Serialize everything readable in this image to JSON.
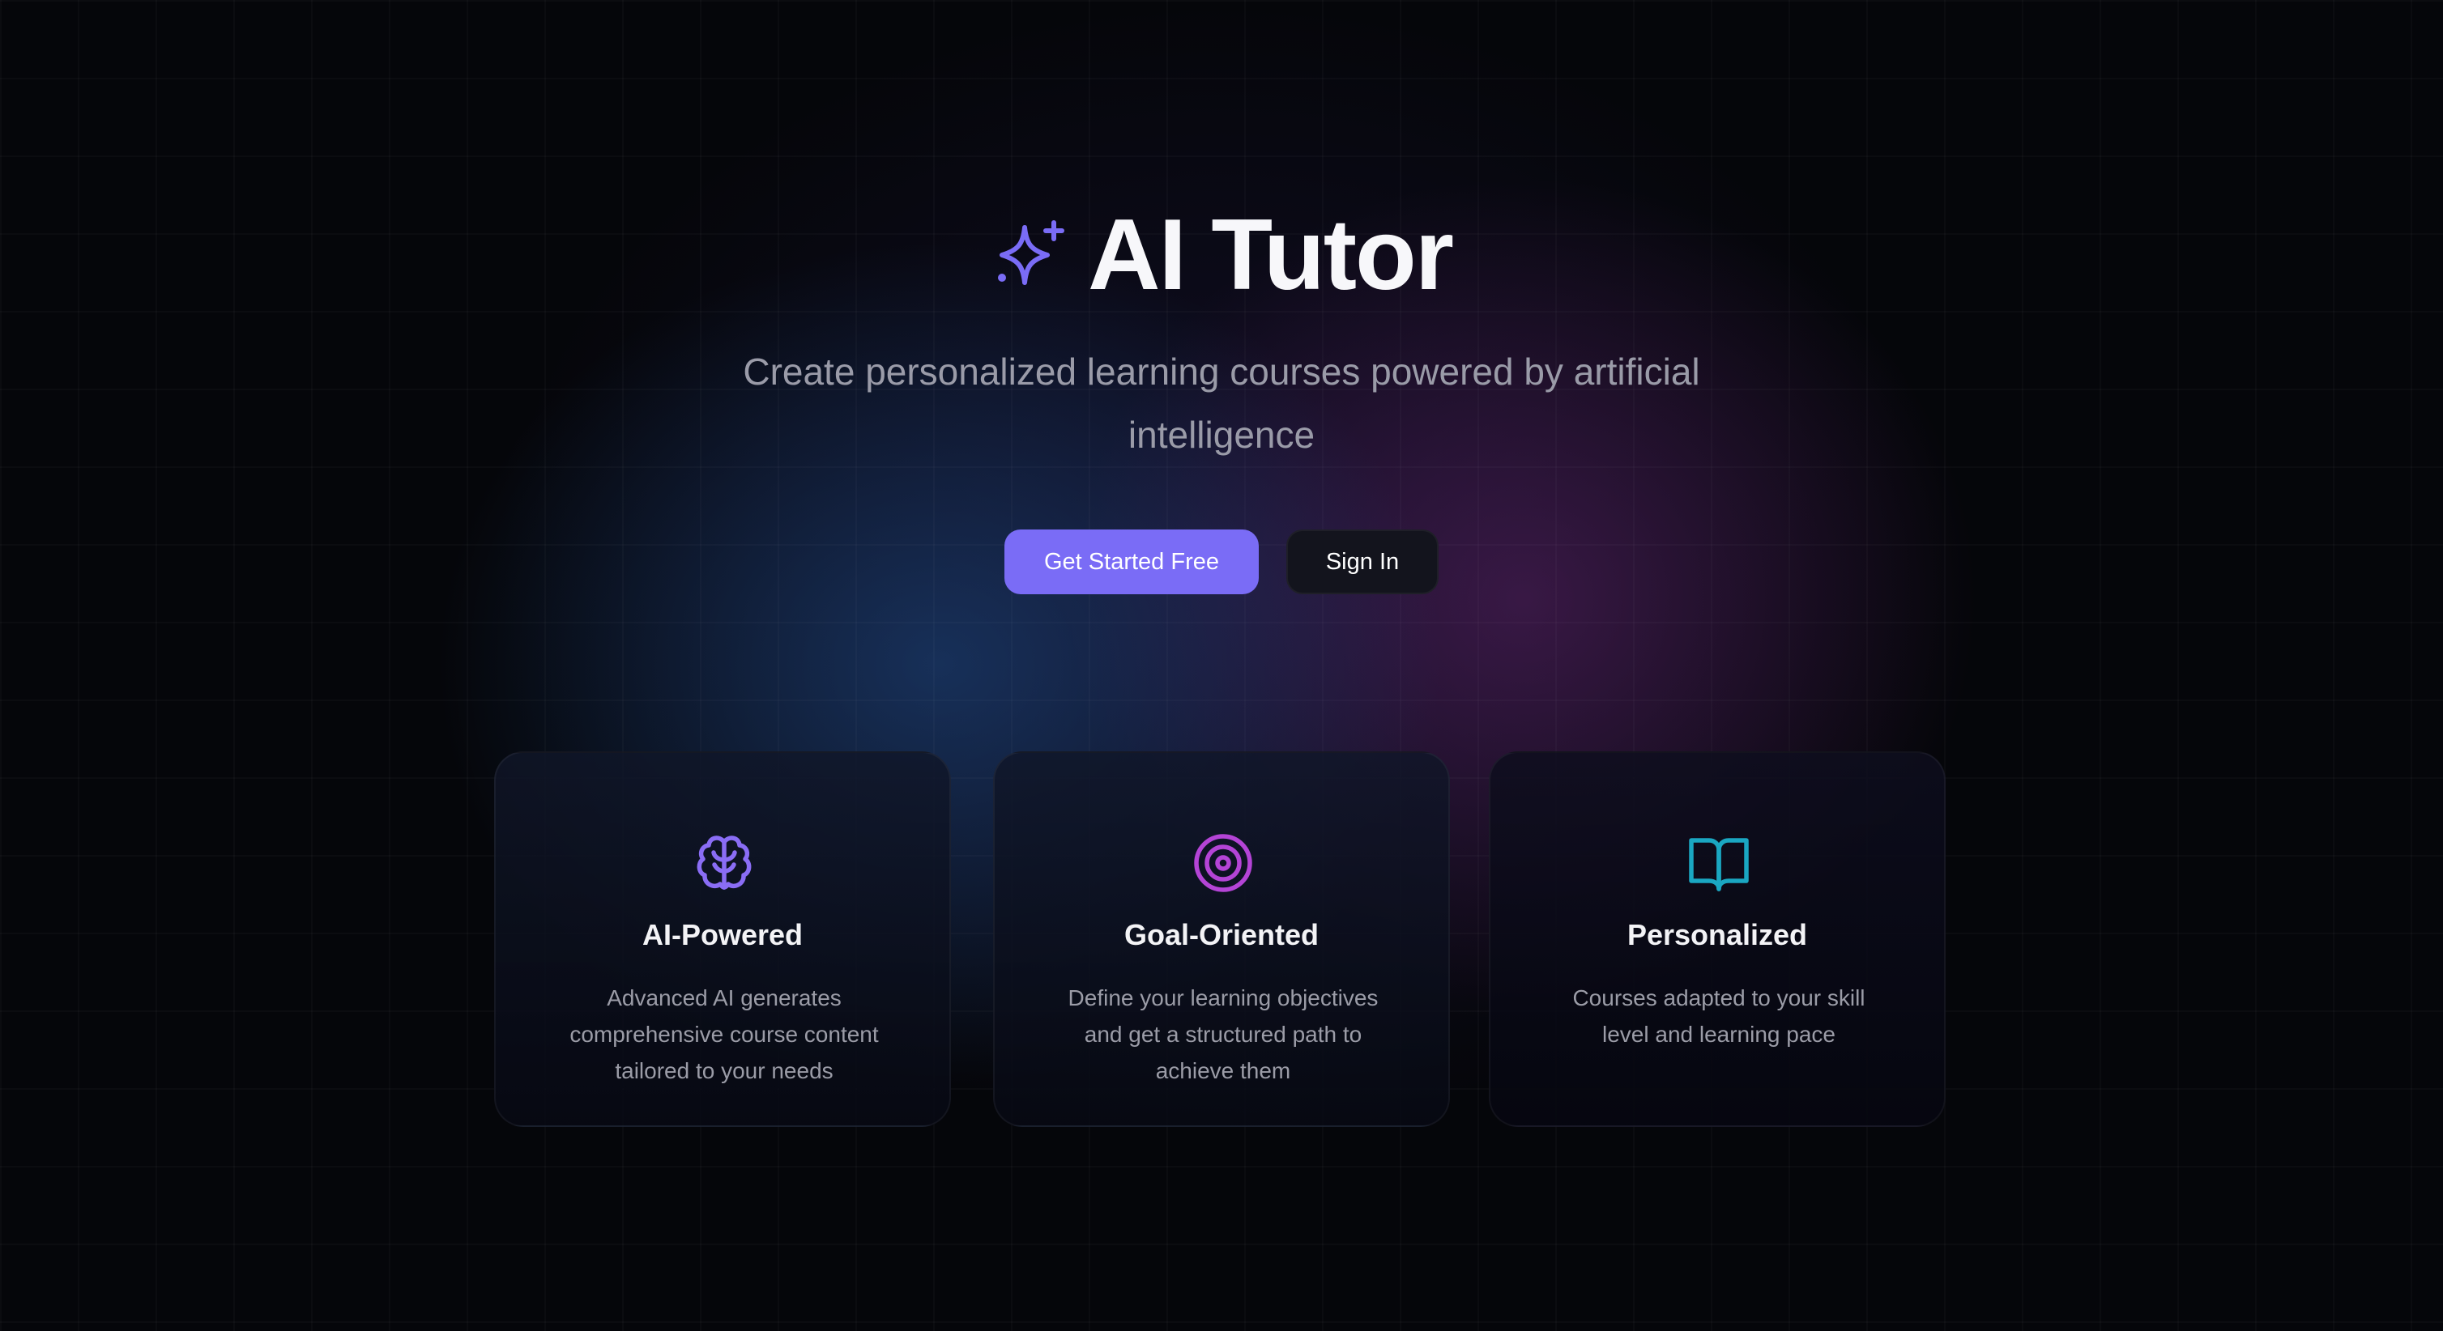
{
  "brand": {
    "title": "AI Tutor",
    "subtitle": "Create personalized learning courses powered by artificial intelligence",
    "icon": "sparkles-icon",
    "accent": "#7a6cf6"
  },
  "cta": {
    "primary_label": "Get Started Free",
    "secondary_label": "Sign In"
  },
  "features": [
    {
      "title": "AI-Powered",
      "description": "Advanced AI generates comprehensive course content tailored to your needs",
      "icon": "brain-icon",
      "color": "#8a6df5"
    },
    {
      "title": "Goal-Oriented",
      "description": "Define your learning objectives and get a structured path to achieve them",
      "icon": "target-icon",
      "color": "#b444d6"
    },
    {
      "title": "Personalized",
      "description": "Courses adapted to your skill level and learning pace",
      "icon": "book-open-icon",
      "color": "#1aa7c2"
    }
  ]
}
